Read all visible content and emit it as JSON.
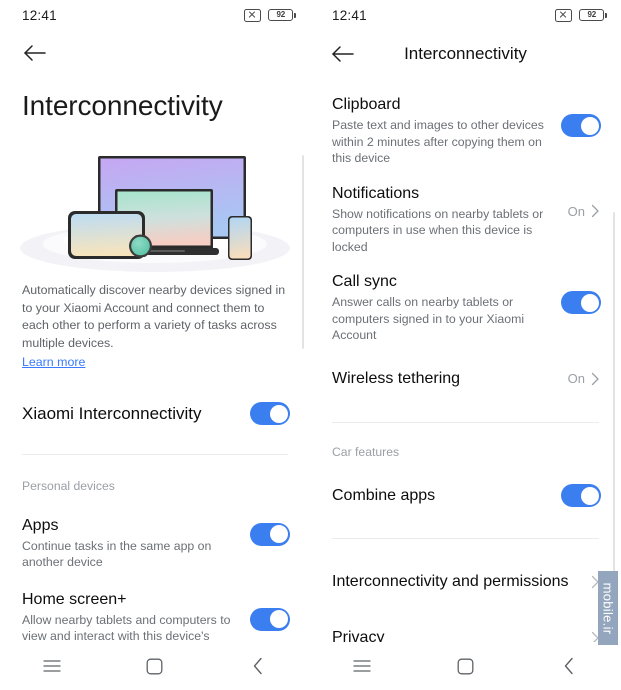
{
  "status_bar": {
    "time": "12:41",
    "mute_icon": "mute-icon",
    "battery_level": "92"
  },
  "left_screen": {
    "back_icon": "back-arrow-icon",
    "page_title": "Interconnectivity",
    "illustration": {
      "name": "multi-device-illustration",
      "devices": [
        "tv",
        "laptop",
        "tablet",
        "smartwatch",
        "phone"
      ],
      "colors": {
        "tv_top": "#c4a6f0",
        "tv_bottom": "#aac5f2",
        "laptop_top": "#a9e3cc",
        "laptop_bottom": "#f5cfc4",
        "tablet_top": "#b9dcf2",
        "tablet_bottom": "#f6e3bc",
        "watch": "#67c9ae",
        "phone_top": "#aed5f3",
        "phone_bottom": "#f6dcbc",
        "pedestal": "#f1f1f5"
      }
    },
    "description": "Automatically discover nearby devices signed in to your Xiaomi Account and connect them to each other to perform a variety of tasks across multiple devices.",
    "learn_more": "Learn more",
    "master_toggle": {
      "label": "Xiaomi Interconnectivity",
      "state": "on"
    },
    "section_label": "Personal devices",
    "items": [
      {
        "title": "Apps",
        "subtitle": "Continue tasks in the same app on another device",
        "control": "toggle",
        "state": "on"
      },
      {
        "title": "Home screen+",
        "subtitle": "Allow nearby tablets and computers to view and interact with this device's Home screen",
        "control": "toggle",
        "state": "on"
      }
    ]
  },
  "right_screen": {
    "back_icon": "back-arrow-icon",
    "title": "Interconnectivity",
    "items": [
      {
        "title": "Clipboard",
        "subtitle": "Paste text and images to other devices within 2 minutes after copying them on this device",
        "control": "toggle",
        "state": "on"
      },
      {
        "title": "Notifications",
        "subtitle": "Show notifications on nearby tablets or computers in use when this device is locked",
        "control": "value",
        "value": "On"
      },
      {
        "title": "Call sync",
        "subtitle": "Answer calls on nearby tablets or computers signed in to your Xiaomi Account",
        "control": "toggle",
        "state": "on"
      },
      {
        "title": "Wireless tethering",
        "subtitle": "",
        "control": "value",
        "value": "On"
      }
    ],
    "section_label": "Car features",
    "car_items": [
      {
        "title": "Combine apps",
        "control": "toggle",
        "state": "on"
      }
    ],
    "link_items": [
      {
        "title": "Interconnectivity and permissions",
        "control": "chevron"
      },
      {
        "title": "Privacy",
        "control": "chevron"
      }
    ]
  },
  "nav_bar": {
    "menu_label": "recents-icon",
    "home_label": "home-icon",
    "back_label": "back-icon"
  },
  "watermark": {
    "text": "mobile.ir"
  },
  "colors": {
    "accent": "#3b7ef0",
    "link": "#3a7afe",
    "muted_text": "#6b7076",
    "section_text": "#9aa0a6",
    "divider": "#ececec"
  }
}
